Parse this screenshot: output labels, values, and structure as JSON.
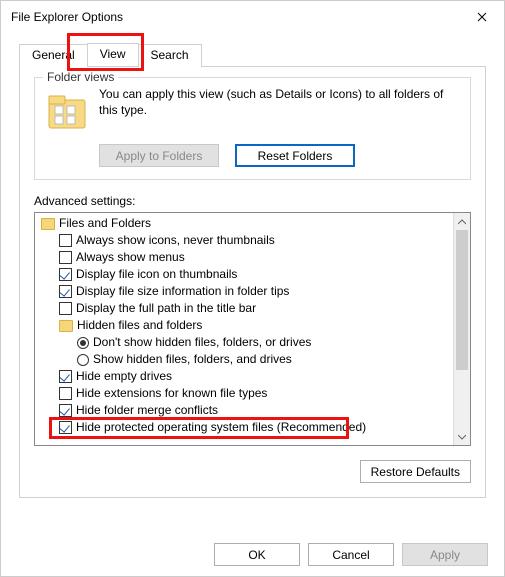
{
  "window": {
    "title": "File Explorer Options"
  },
  "tabs": {
    "general": "General",
    "view": "View",
    "search": "Search"
  },
  "folderViews": {
    "legend": "Folder views",
    "text": "You can apply this view (such as Details or Icons) to all folders of this type.",
    "applyBtn": "Apply to Folders",
    "resetBtn": "Reset Folders"
  },
  "advanced": {
    "label": "Advanced settings:",
    "root": "Files and Folders",
    "items": [
      {
        "type": "check",
        "checked": false,
        "label": "Always show icons, never thumbnails"
      },
      {
        "type": "check",
        "checked": false,
        "label": "Always show menus"
      },
      {
        "type": "check",
        "checked": true,
        "label": "Display file icon on thumbnails"
      },
      {
        "type": "check",
        "checked": true,
        "label": "Display file size information in folder tips"
      },
      {
        "type": "check",
        "checked": false,
        "label": "Display the full path in the title bar"
      },
      {
        "type": "folder",
        "label": "Hidden files and folders"
      },
      {
        "type": "radio",
        "checked": true,
        "label": "Don't show hidden files, folders, or drives"
      },
      {
        "type": "radio",
        "checked": false,
        "label": "Show hidden files, folders, and drives"
      },
      {
        "type": "check",
        "checked": true,
        "label": "Hide empty drives"
      },
      {
        "type": "check",
        "checked": false,
        "label": "Hide extensions for known file types"
      },
      {
        "type": "check",
        "checked": true,
        "label": "Hide folder merge conflicts"
      },
      {
        "type": "check",
        "checked": true,
        "label": "Hide protected operating system files (Recommended)"
      }
    ],
    "restoreBtn": "Restore Defaults"
  },
  "dialogButtons": {
    "ok": "OK",
    "cancel": "Cancel",
    "apply": "Apply"
  }
}
